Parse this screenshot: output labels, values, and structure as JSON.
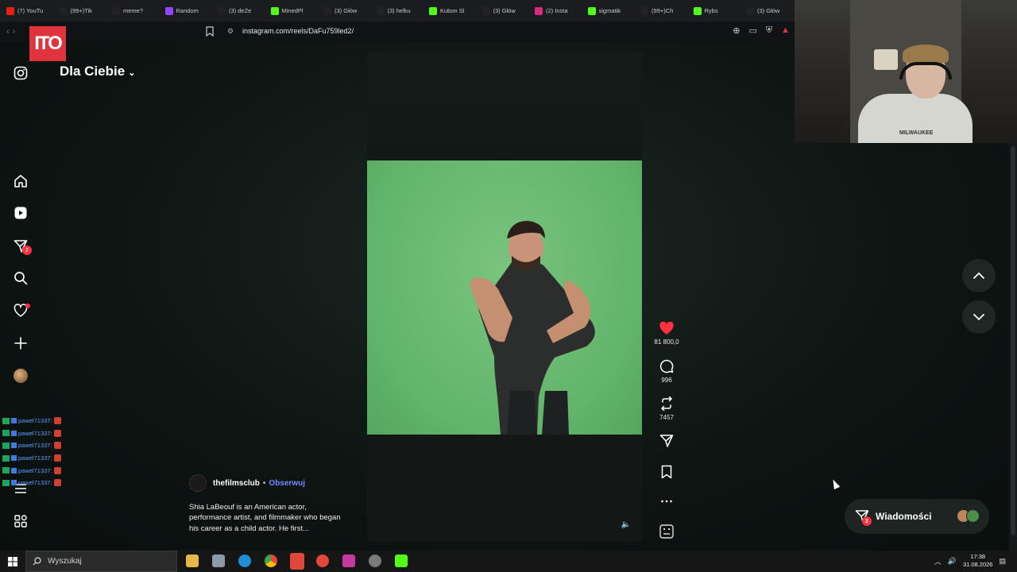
{
  "browser": {
    "tabs": [
      {
        "label": "(7) YouTu",
        "icon": "youtube-icon",
        "color": "#e62117"
      },
      {
        "label": "(99+)Tik",
        "icon": "tiktok-icon",
        "color": "#222222"
      },
      {
        "label": "meme?",
        "icon": "tiktok-icon",
        "color": "#222222"
      },
      {
        "label": "Random",
        "icon": "twitch-icon",
        "color": "#9146ff"
      },
      {
        "label": "(3) deZe",
        "icon": "x-icon",
        "color": "#222222"
      },
      {
        "label": "MinedPl",
        "icon": "kick-icon",
        "color": "#53fc18"
      },
      {
        "label": "(3) Głów",
        "icon": "x-icon",
        "color": "#222222"
      },
      {
        "label": "(3) helku",
        "icon": "x-icon",
        "color": "#222222"
      },
      {
        "label": "Kubon Sl",
        "icon": "kick-icon",
        "color": "#53fc18"
      },
      {
        "label": "(3) Głów",
        "icon": "x-icon",
        "color": "#222222"
      },
      {
        "label": "(2) Insta",
        "icon": "instagram-icon",
        "color": "#dd2a7b"
      },
      {
        "label": "sigmatik",
        "icon": "kick-icon",
        "color": "#53fc18"
      },
      {
        "label": "(99+)Ch",
        "icon": "tiktok-icon",
        "color": "#222222"
      },
      {
        "label": "Rybs",
        "icon": "kick-icon",
        "color": "#53fc18"
      },
      {
        "label": "(3) Głów",
        "icon": "x-icon",
        "color": "#222222"
      }
    ],
    "url": "instagram.com/reels/DaFu759led2/"
  },
  "stream_logo": "ITO",
  "sidebar": {
    "feed_title": "Dla Ciebie",
    "messages_badge": "2",
    "items": [
      {
        "name": "instagram-icon"
      },
      {
        "name": "home-icon"
      },
      {
        "name": "reels-icon"
      },
      {
        "name": "direct-icon"
      },
      {
        "name": "search-icon"
      },
      {
        "name": "heart-icon"
      },
      {
        "name": "plus-icon"
      },
      {
        "name": "avatar"
      }
    ]
  },
  "chat": {
    "lines": [
      {
        "user": "pawel71337:"
      },
      {
        "user": "pawel71337:"
      },
      {
        "user": "pawel71337:"
      },
      {
        "user": "pawel71337:"
      },
      {
        "user": "pawel71337:"
      },
      {
        "user": "pawel71337:"
      }
    ]
  },
  "reel": {
    "likes": "81 800,0",
    "comments": "996",
    "reposts": "7457",
    "author": "thefilmsclub",
    "separator": "•",
    "follow_label": "Obserwuj",
    "caption": "Shia LaBeouf is an American actor, performance artist, and filmmaker who began his career as a child actor. He first..."
  },
  "messages_pill": {
    "label": "Wiadomości",
    "badge": "2"
  },
  "webcam": {
    "shirt_text": "MILWAUKEE"
  },
  "taskbar": {
    "search_placeholder": "Wyszukaj",
    "time": "17:38",
    "date": "31.08.2026"
  },
  "colors": {
    "accent_red": "#ff3040",
    "like_red": "#ff3040",
    "follow_blue": "#6f8cff",
    "greenscreen": "#66b66d"
  }
}
